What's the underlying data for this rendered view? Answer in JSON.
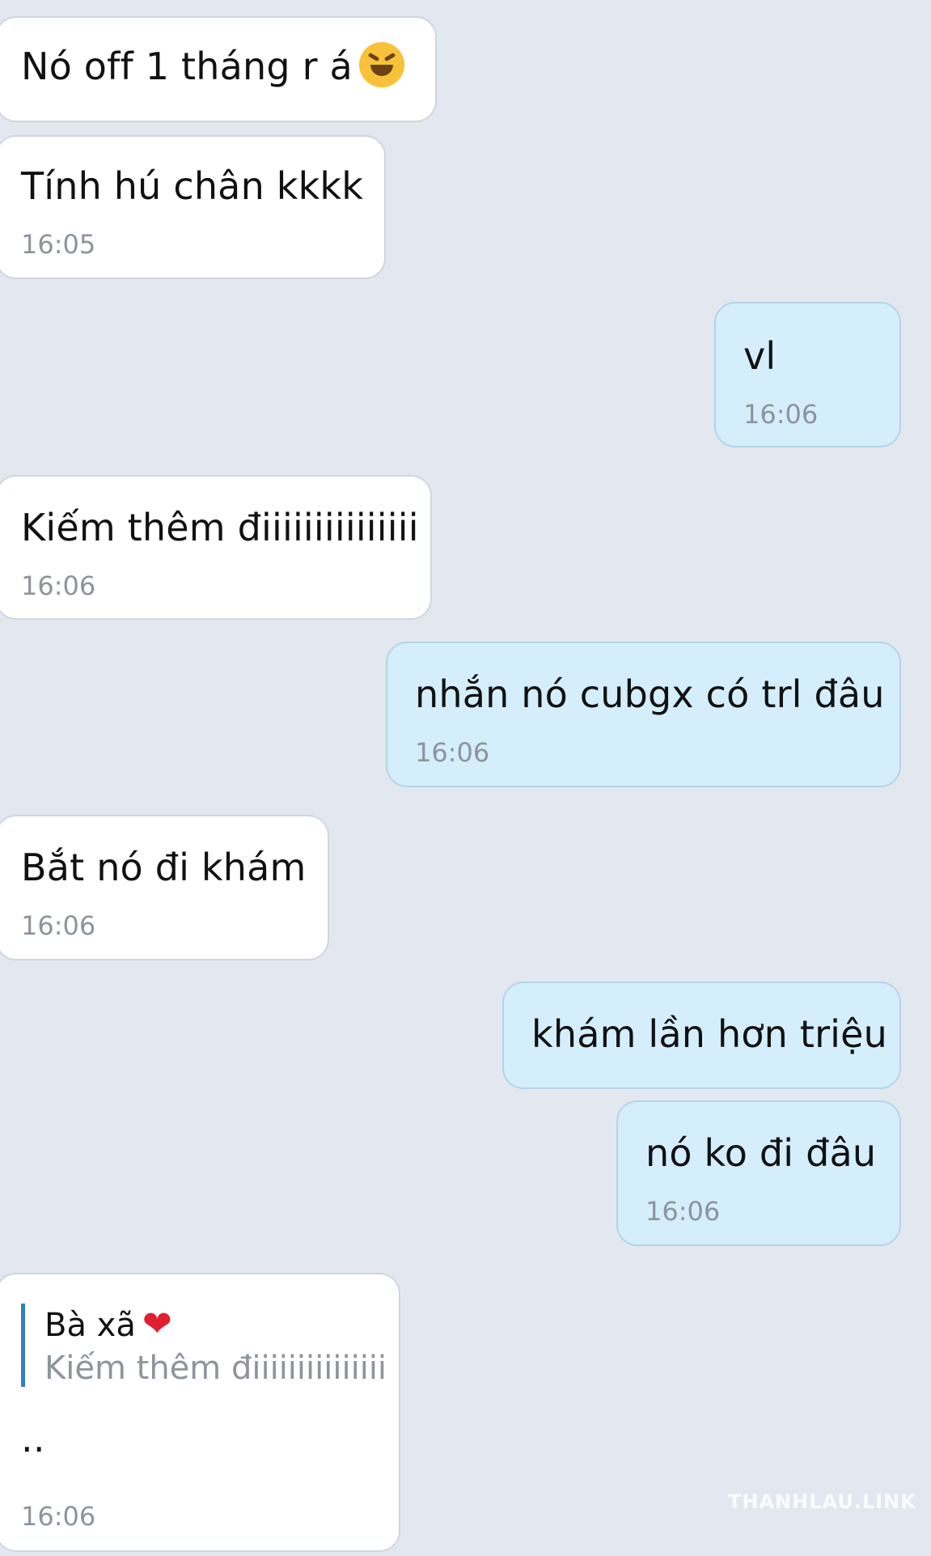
{
  "messages": [
    {
      "text": "Nó off 1 tháng r á",
      "emoji": "rolling-on-floor-laughing-emoji"
    },
    {
      "text": "Tính hú chân kkkk",
      "time": "16:05"
    },
    {
      "text": "vl",
      "time": "16:06"
    },
    {
      "text": "Kiếm thêm điiiiiiiiiiiiiii",
      "time": "16:06"
    },
    {
      "text": "nhắn nó cubgx có trl đâu",
      "time": "16:06"
    },
    {
      "text": "Bắt nó đi khám",
      "time": "16:06"
    },
    {
      "text": "khám lần hơn triệu"
    },
    {
      "text": "nó ko đi đâu",
      "time": "16:06"
    },
    {
      "reply_name": "Bà xã",
      "reply_icon": "red-heart",
      "reply_text": "Kiếm thêm điiiiiiiiiiiiiii",
      "text": "..",
      "time": "16:06"
    }
  ],
  "colors": {
    "incoming": "#ffffff",
    "outgoing": "#d4eefc",
    "background": "#e3e8f0",
    "quote_bar": "#2f80c8"
  },
  "watermark": "THANHLAU.LINK"
}
